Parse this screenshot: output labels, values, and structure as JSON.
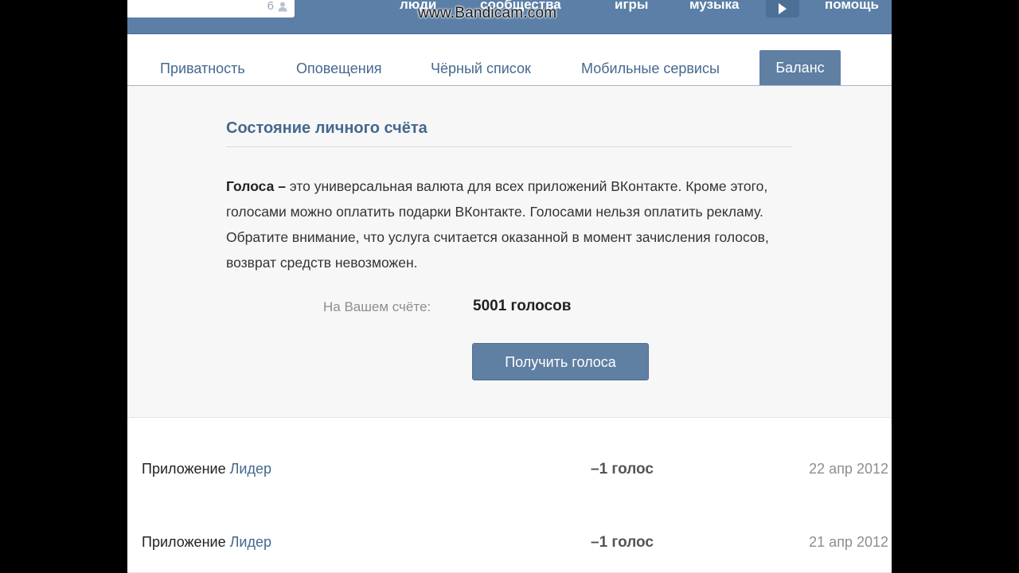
{
  "colors": {
    "header_bg": "#5b7fa6",
    "accent": "#45688e",
    "button_bg": "#5f7fa3",
    "panel_bg": "#f7f7f7"
  },
  "header": {
    "search_count": "6",
    "nav": [
      "люди",
      "сообщества",
      "игры",
      "музыка",
      "помощь"
    ],
    "play_icon": "play-icon"
  },
  "watermark": "www.Bandicam.com",
  "tabs": [
    {
      "label": "Приватность",
      "active": false
    },
    {
      "label": "Оповещения",
      "active": false
    },
    {
      "label": "Чёрный список",
      "active": false
    },
    {
      "label": "Мобильные сервисы",
      "active": false
    },
    {
      "label": "Баланс",
      "active": true
    }
  ],
  "balance": {
    "title": "Состояние личного счёта",
    "desc_bold": "Голоса –",
    "desc_text": " это универсальная валюта для всех приложений ВКонтакте. Кроме этого, голосами можно оплатить подарки ВКонтакте. Голосами нельзя оплатить рекламу. Обратите внимание, что услуга считается оказанной в момент зачисления голосов, возврат средств невозможен.",
    "account_label": "На Вашем счёте:",
    "account_value": "5001 голосов",
    "button_label": "Получить голоса"
  },
  "transactions": [
    {
      "prefix": "Приложение",
      "app": "Лидер",
      "amount": "–1 голос",
      "date": "22 апр 2012"
    },
    {
      "prefix": "Приложение",
      "app": "Лидер",
      "amount": "–1 голос",
      "date": "21 апр 2012"
    }
  ]
}
